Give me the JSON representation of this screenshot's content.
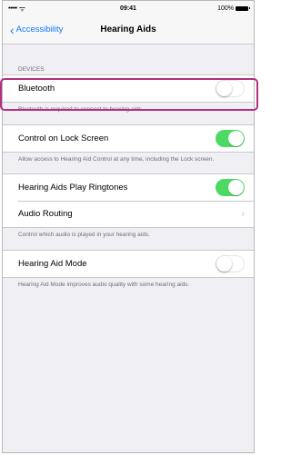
{
  "status_bar": {
    "signal": "•••••",
    "time": "09:41",
    "battery": "100%"
  },
  "nav": {
    "back_label": "Accessibility",
    "title": "Hearing Aids"
  },
  "devices": {
    "header": "DEVICES",
    "bluetooth_label": "Bluetooth",
    "bluetooth_on": false,
    "footer": "Bluetooth is required to connect to hearing aids."
  },
  "lock_screen": {
    "label": "Control on Lock Screen",
    "on": true,
    "footer": "Allow access to Hearing Aid Control at any time, including the Lock screen."
  },
  "ringtones": {
    "label": "Hearing Aids Play Ringtones",
    "on": true,
    "audio_routing_label": "Audio Routing",
    "footer": "Control which audio is played in your hearing aids."
  },
  "mode": {
    "label": "Hearing Aid Mode",
    "on": false,
    "footer": "Hearing Aid Mode improves audio quality with some hearing aids."
  },
  "colors": {
    "accent": "#1478fa",
    "toggle_on": "#4cd964",
    "highlight": "#b3307f"
  }
}
